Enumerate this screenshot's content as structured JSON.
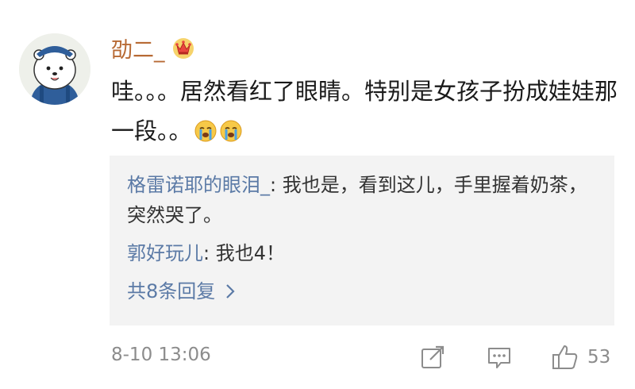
{
  "comment": {
    "username": "劭二_",
    "vip_badge_icon": "crown-vip-icon",
    "body": "哇。。。居然看红了眼睛。特别是女孩子扮成娃娃那一段。。",
    "emojis": [
      "crying-emoji-icon",
      "crying-emoji-icon"
    ],
    "timestamp": "8-10 13:06",
    "like_count": "53"
  },
  "replies": [
    {
      "author": "格雷诺耶的眼泪_",
      "separator": ": ",
      "text": "我也是，看到这儿，手里握着奶茶，突然哭了。"
    },
    {
      "author": "郭好玩儿",
      "separator": ": ",
      "text": "我也4！"
    }
  ],
  "more_replies_label": "共8条回复",
  "colors": {
    "username": "#b76a34",
    "reply_author": "#5b7aa6",
    "reply_background": "#f3f3f3",
    "meta_gray": "#8c8c8c"
  }
}
